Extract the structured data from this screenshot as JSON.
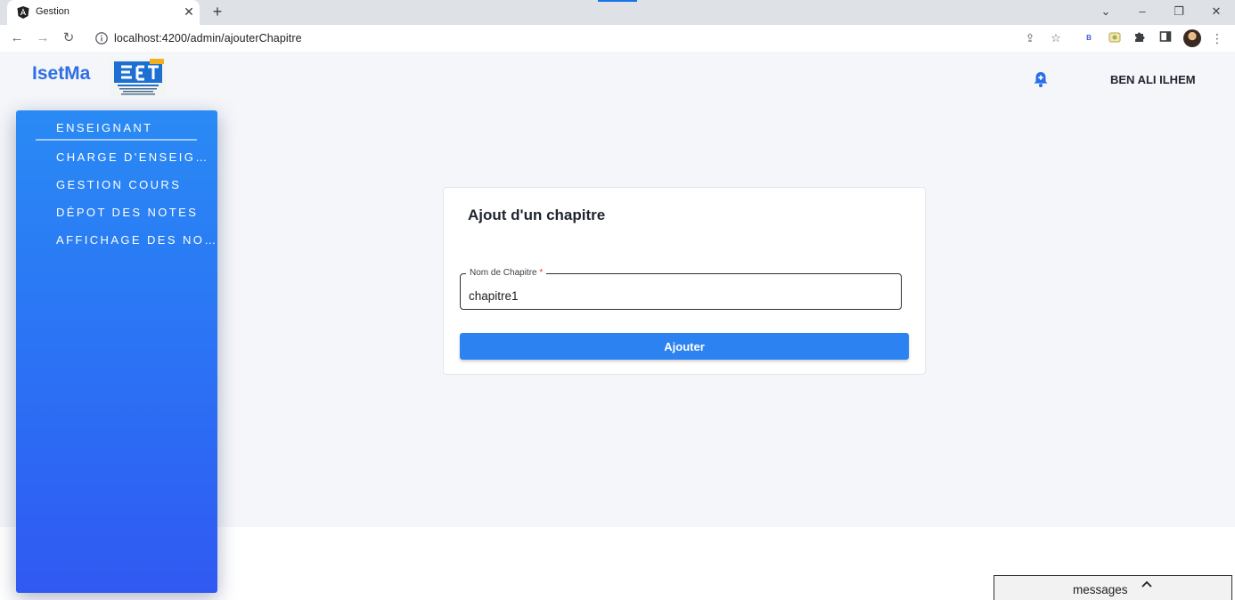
{
  "browser": {
    "tab_title": "Gestion",
    "tab_close": "✕",
    "new_tab": "+",
    "url": "localhost:4200/admin/ajouterChapitre",
    "window_controls": {
      "minimize": "–",
      "maximize": "❐",
      "close": "✕",
      "tab_search": "⌄"
    },
    "toolbar_icons": [
      "share-icon",
      "star-icon",
      "extension-b-icon",
      "extension-image-icon",
      "puzzle-icon",
      "side-panel-icon",
      "profile-avatar",
      "menu-icon"
    ]
  },
  "app": {
    "brand": "IsetMa",
    "user_name": "BEN ALI ILHEM"
  },
  "sidebar": {
    "items": [
      {
        "label": "ENSEIGNANT",
        "active": true
      },
      {
        "label": "CHARGE D'ENSEIGNANT"
      },
      {
        "label": "GESTION COURS"
      },
      {
        "label": "DÉPOT DES NOTES"
      },
      {
        "label": "AFFICHAGE DES NOTES"
      }
    ]
  },
  "form": {
    "title": "Ajout d'un chapitre",
    "field_label": "Nom de Chapitre",
    "required_mark": "*",
    "field_value": "chapitre1",
    "submit_label": "Ajouter"
  },
  "messages": {
    "label": "messages"
  },
  "colors": {
    "accent": "#2b82f0",
    "sidebar_top": "#2a8af4",
    "sidebar_bottom": "#3059f2",
    "brand": "#2f6fe6"
  }
}
